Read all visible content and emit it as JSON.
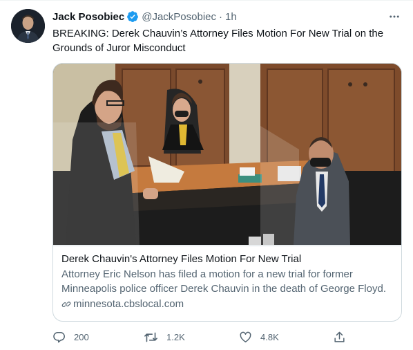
{
  "tweet": {
    "display_name": "Jack Posobiec",
    "handle": "@JackPosobiec",
    "separator": "·",
    "time": "1h",
    "text": "BREAKING: Derek Chauvin’s Attorney Files Motion For New Trial on the Grounds of Juror Misconduct"
  },
  "card": {
    "title": "Derek Chauvin's Attorney Files Motion For New Trial",
    "description": "Attorney Eric Nelson has filed a motion for a new trial for former Minneapolis police officer Derek Chauvin in the death of George Floyd.",
    "domain": "minnesota.cbslocal.com"
  },
  "actions": {
    "replies": "200",
    "retweets": "1.2K",
    "likes": "4.8K"
  },
  "colors": {
    "text_primary": "#0f1419",
    "text_secondary": "#536471",
    "verified_blue": "#1d9bf0",
    "border": "#cfd9de"
  },
  "icons": [
    "verified-badge-icon",
    "more-icon",
    "link-icon",
    "reply-icon",
    "retweet-icon",
    "like-icon",
    "share-icon"
  ]
}
